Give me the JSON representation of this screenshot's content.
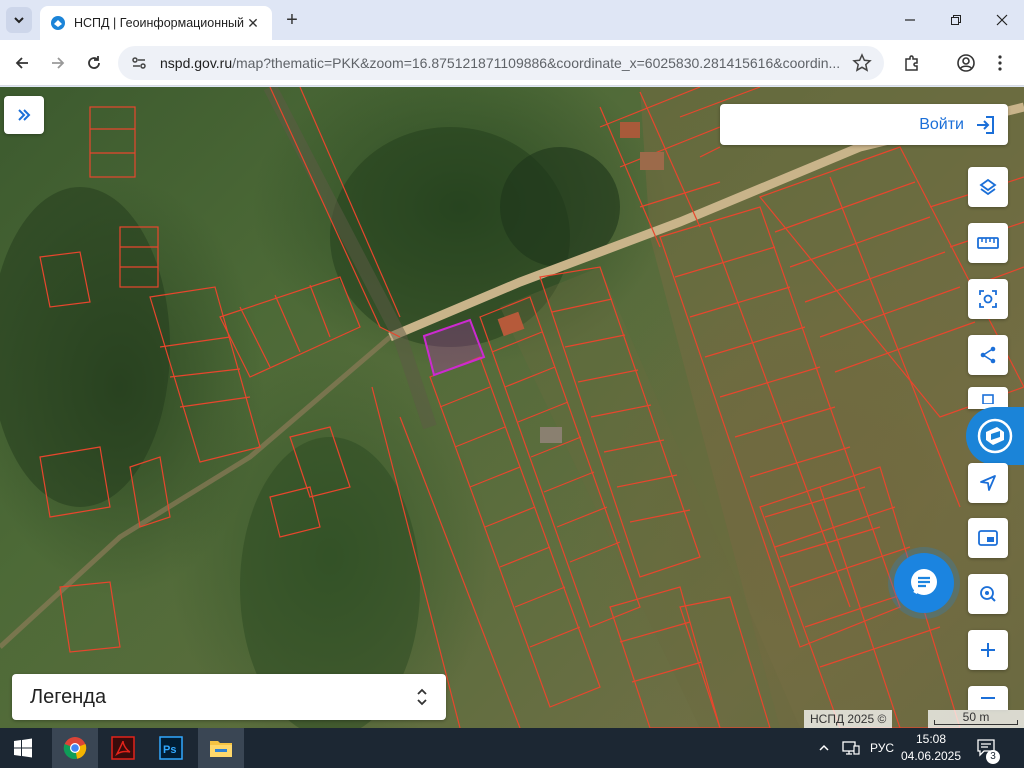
{
  "browser": {
    "tab_title": "НСПД | Геоинформационный",
    "url_host": "nspd.gov.ru",
    "url_path": "/map?thematic=PKK&zoom=16.875121871109886&coordinate_x=6025830.281415616&coordin..."
  },
  "map": {
    "login_label": "Войти",
    "legend_label": "Легенда",
    "attribution": "НСПД 2025 ©",
    "scale_label": "50 m",
    "parcel_color": "#e8462d",
    "selected_parcel_color": "#cc2ad0",
    "accent_color": "#1b6fd8",
    "tool_icons": [
      "layers-icon",
      "ruler-icon",
      "area-select-icon",
      "share-icon",
      "print-icon",
      "navigate-icon",
      "map-frame-icon",
      "geo-search-icon",
      "zoom-in-icon",
      "zoom-out-icon"
    ]
  },
  "taskbar": {
    "apps": [
      "chrome-icon",
      "acrobat-icon",
      "photoshop-icon",
      "file-explorer-icon"
    ],
    "lang": "РУС",
    "time": "15:08",
    "date": "04.06.2025",
    "notifications": "3"
  }
}
